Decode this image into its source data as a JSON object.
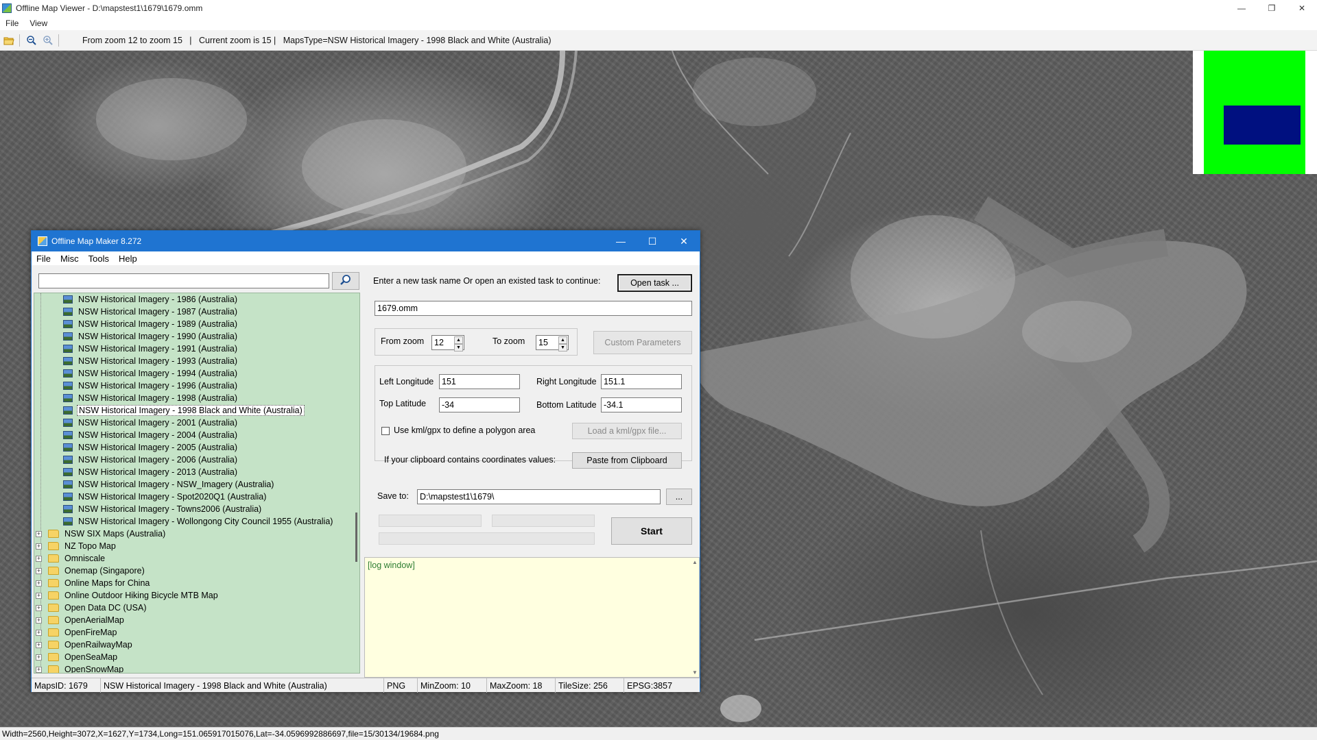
{
  "viewer": {
    "title": "Offline Map Viewer - D:\\mapstest1\\1679\\1679.omm",
    "menu": [
      "File",
      "View"
    ],
    "toolbar_status": "From zoom 12 to zoom 15   |   Current zoom is 15 |   MapsType=NSW Historical Imagery - 1998 Black and White (Australia)",
    "statusbar": "Width=2560,Height=3072,X=1627,Y=1734,Long=151.065917015076,Lat=-34.0596992886697,file=15/30134/19684.png"
  },
  "dialog": {
    "title": "Offline Map Maker 8.272",
    "menu": [
      "File",
      "Misc",
      "Tools",
      "Help"
    ],
    "search": {
      "value": ""
    },
    "tree": {
      "children": [
        "NSW Historical Imagery - 1986 (Australia)",
        "NSW Historical Imagery - 1987 (Australia)",
        "NSW Historical Imagery - 1989 (Australia)",
        "NSW Historical Imagery - 1990 (Australia)",
        "NSW Historical Imagery - 1991 (Australia)",
        "NSW Historical Imagery - 1993 (Australia)",
        "NSW Historical Imagery - 1994 (Australia)",
        "NSW Historical Imagery - 1996 (Australia)",
        "NSW Historical Imagery - 1998 (Australia)",
        "NSW Historical Imagery - 1998 Black and White (Australia)",
        "NSW Historical Imagery - 2001 (Australia)",
        "NSW Historical Imagery - 2004 (Australia)",
        "NSW Historical Imagery - 2005 (Australia)",
        "NSW Historical Imagery - 2006 (Australia)",
        "NSW Historical Imagery - 2013 (Australia)",
        "NSW Historical Imagery - NSW_Imagery (Australia)",
        "NSW Historical Imagery - Spot2020Q1 (Australia)",
        "NSW Historical Imagery - Towns2006 (Australia)",
        "NSW Historical Imagery - Wollongong City Council 1955 (Australia)"
      ],
      "selected_index": 9,
      "folders": [
        "NSW SIX Maps (Australia)",
        "NZ Topo Map",
        "Omniscale",
        "Onemap (Singapore)",
        "Online Maps for China",
        "Online Outdoor Hiking Bicycle MTB Map",
        "Open Data DC (USA)",
        "OpenAerialMap",
        "OpenFireMap",
        "OpenRailwayMap",
        "OpenSeaMap",
        "OpenSnowMap"
      ]
    },
    "task_prompt": "Enter a new task name Or open an existed task to continue:",
    "open_task_label": "Open task ...",
    "task_name": "1679.omm",
    "from_zoom_label": "From zoom",
    "from_zoom": "12",
    "to_zoom_label": "To zoom",
    "to_zoom": "15",
    "custom_params_label": "Custom Parameters",
    "left_lon_label": "Left Longitude",
    "left_lon": "151",
    "right_lon_label": "Right Longitude",
    "right_lon": "151.1",
    "top_lat_label": "Top Latitude",
    "top_lat": "-34",
    "bottom_lat_label": "Bottom Latitude",
    "bottom_lat": "-34.1",
    "kml_checkbox_label": "Use kml/gpx to define a polygon area",
    "load_kml_label": "Load a kml/gpx file...",
    "clipboard_prompt": "If your clipboard contains coordinates values:",
    "paste_label": "Paste from Clipboard",
    "save_to_label": "Save to:",
    "save_to": "D:\\mapstest1\\1679\\",
    "browse_label": "...",
    "start_label": "Start",
    "log_text": "[log window]",
    "status": {
      "maps_id": "MapsID: 1679",
      "map_name": "NSW Historical Imagery - 1998 Black and White (Australia)",
      "format": "PNG",
      "min_zoom": "MinZoom: 10",
      "max_zoom": "MaxZoom: 18",
      "tile_size": "TileSize: 256",
      "epsg": "EPSG:3857"
    }
  },
  "colors": {
    "dialog_title": "#1f74d1",
    "tree_bg": "#c5e3c7",
    "log_bg": "#ffffe0",
    "minimap_green": "#00ff00",
    "minimap_blue": "#001080"
  },
  "icons": [
    "open-folder-icon",
    "zoom-out-icon",
    "zoom-in-icon",
    "search-icon",
    "minimize-icon",
    "maximize-icon",
    "close-icon"
  ]
}
